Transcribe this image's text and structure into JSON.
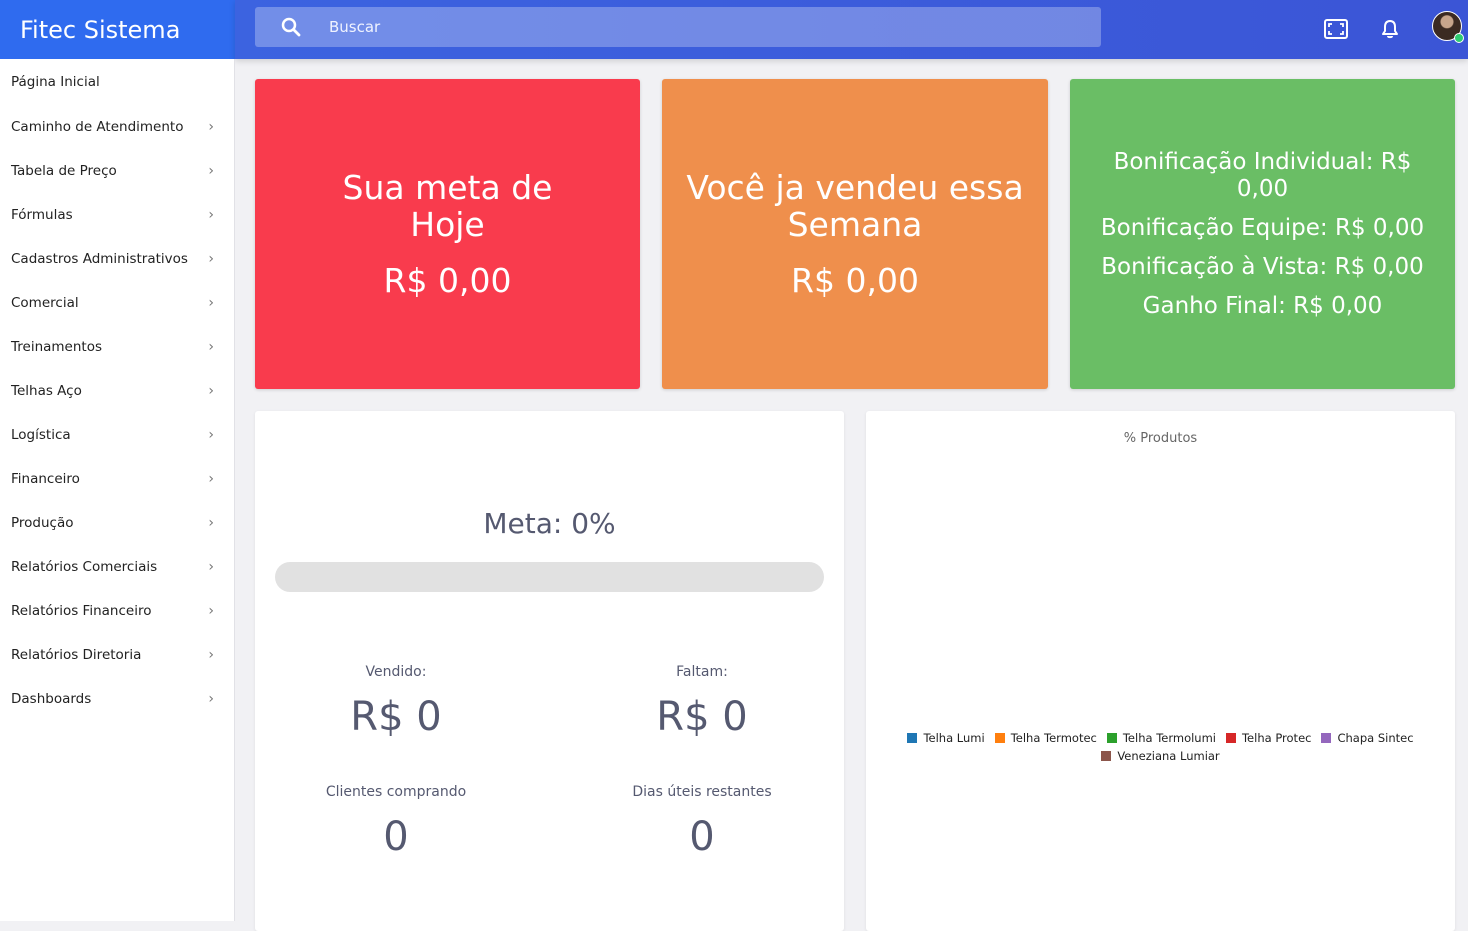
{
  "app": {
    "title": "Fitec Sistema"
  },
  "search": {
    "placeholder": "Buscar"
  },
  "sidebar": {
    "items": [
      {
        "label": "Página Inicial",
        "has_children": false
      },
      {
        "label": "Caminho de Atendimento",
        "has_children": true
      },
      {
        "label": "Tabela de Preço",
        "has_children": true
      },
      {
        "label": "Fórmulas",
        "has_children": true
      },
      {
        "label": "Cadastros Administrativos",
        "has_children": true
      },
      {
        "label": "Comercial",
        "has_children": true
      },
      {
        "label": "Treinamentos",
        "has_children": true
      },
      {
        "label": "Telhas Aço",
        "has_children": true
      },
      {
        "label": "Logística",
        "has_children": true
      },
      {
        "label": "Financeiro",
        "has_children": true
      },
      {
        "label": "Produção",
        "has_children": true
      },
      {
        "label": "Relatórios Comerciais",
        "has_children": true
      },
      {
        "label": "Relatórios Financeiro",
        "has_children": true
      },
      {
        "label": "Relatórios Diretoria",
        "has_children": true
      },
      {
        "label": "Dashboards",
        "has_children": true
      }
    ]
  },
  "cards": {
    "meta_hoje": {
      "title": "Sua meta de Hoje",
      "value": "R$ 0,00",
      "color": "#f93b4d"
    },
    "vendeu_semana": {
      "title": "Você ja vendeu essa Semana",
      "value": "R$ 0,00",
      "color": "#ef8f4c"
    },
    "bonificacao": {
      "color": "#6abe65",
      "lines": [
        "Bonificação Individual: R$ 0,00",
        "Bonificação Equipe: R$ 0,00",
        "Bonificação à Vista: R$ 0,00",
        "Ganho Final: R$ 0,00"
      ]
    }
  },
  "meta": {
    "title": "Meta: 0%",
    "progress_percent": 0,
    "vendido_label": "Vendido:",
    "vendido_value": "R$ 0",
    "faltam_label": "Faltam:",
    "faltam_value": "R$ 0",
    "clientes_label": "Clientes comprando",
    "clientes_value": "0",
    "dias_label": "Dias úteis restantes",
    "dias_value": "0"
  },
  "chart_data": {
    "type": "pie",
    "title": "% Produtos",
    "categories": [
      "Telha Lumi",
      "Telha Termotec",
      "Telha Termolumi",
      "Telha Protec",
      "Chapa Sintec",
      "Veneziana Lumiar"
    ],
    "values": [],
    "colors": [
      "#1f77b4",
      "#ff7f0e",
      "#2ca02c",
      "#d62728",
      "#9467bd",
      "#8c564b"
    ],
    "legend": "bottom"
  },
  "icons": {
    "search": "search-icon",
    "fullscreen": "fullscreen-icon",
    "bell": "bell-icon",
    "avatar": "user-avatar"
  }
}
